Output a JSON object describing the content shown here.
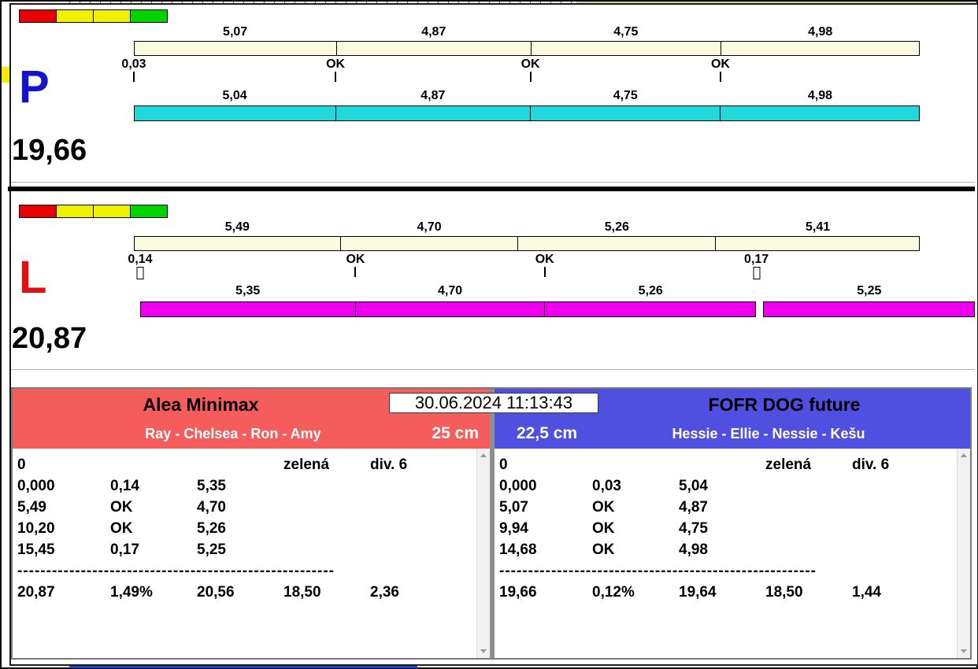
{
  "datetime": "30.06.2024 11:13:43",
  "colors": {
    "cream_bar": "#fbfbdf",
    "cyan_bar": "#1fd9dd",
    "magenta_bar": "#ee00ee",
    "p_letter": "#1414cc",
    "l_letter": "#dd1111",
    "left_header": "#f55c5c",
    "right_header": "#5050e0",
    "block_red": "#e60000",
    "block_yellow": "#f0f000",
    "block_green": "#00d300"
  },
  "panels": {
    "p": {
      "letter": "P",
      "total": "19,66",
      "status_blocks": [
        "red",
        "yellow",
        "yellow",
        "green"
      ],
      "ref_labels": [
        "5,07",
        "4,87",
        "4,75",
        "4,98"
      ],
      "ref_values": [
        5.07,
        4.87,
        4.75,
        4.98
      ],
      "mark_start": "0,03",
      "marks": [
        "OK",
        "OK",
        "OK"
      ],
      "run_labels": [
        "5,04",
        "4,87",
        "4,75",
        "4,98"
      ],
      "run_values": [
        5.04,
        4.87,
        4.75,
        4.98
      ]
    },
    "l": {
      "letter": "L",
      "total": "20,87",
      "status_blocks": [
        "red",
        "yellow",
        "yellow",
        "green"
      ],
      "ref_labels": [
        "5,49",
        "4,70",
        "5,26",
        "5,41"
      ],
      "ref_values": [
        5.49,
        4.7,
        5.26,
        5.41
      ],
      "mark_start": "0,14",
      "marks": [
        "OK",
        "OK",
        "0,17"
      ],
      "run_labels": [
        "5,35",
        "4,70",
        "5,26",
        "5,25"
      ],
      "run_values": [
        5.35,
        4.7,
        5.26,
        5.25
      ]
    }
  },
  "tables": {
    "left": {
      "title": "Alea Minimax",
      "subtitle": "Ray - Chelsea - Ron - Amy",
      "jump_height": "25 cm",
      "rows": [
        [
          "0",
          "",
          "",
          "zelená",
          "div. 6"
        ],
        [
          "0,000",
          "0,14",
          "5,35",
          "",
          ""
        ],
        [
          "5,49",
          "OK",
          "4,70",
          "",
          ""
        ],
        [
          "10,20",
          "OK",
          "5,26",
          "",
          ""
        ],
        [
          "15,45",
          "0,17",
          "5,25",
          "",
          ""
        ]
      ],
      "divider": "-------------------------------------------------------",
      "totals": [
        "20,87",
        "1,49%",
        "20,56",
        "18,50",
        "2,36"
      ]
    },
    "right": {
      "title": "FOFR DOG future",
      "subtitle": "Hessie - Ellie - Nessie - Kešu",
      "jump_height": "22,5 cm",
      "rows": [
        [
          "0",
          "",
          "",
          "zelená",
          "div. 6"
        ],
        [
          "0,000",
          "0,03",
          "5,04",
          "",
          ""
        ],
        [
          "5,07",
          "OK",
          "4,87",
          "",
          ""
        ],
        [
          "9,94",
          "OK",
          "4,75",
          "",
          ""
        ],
        [
          "14,68",
          "OK",
          "4,98",
          "",
          ""
        ]
      ],
      "divider": "-------------------------------------------------------",
      "totals": [
        "19,66",
        "0,12%",
        "19,64",
        "18,50",
        "1,44"
      ]
    }
  }
}
